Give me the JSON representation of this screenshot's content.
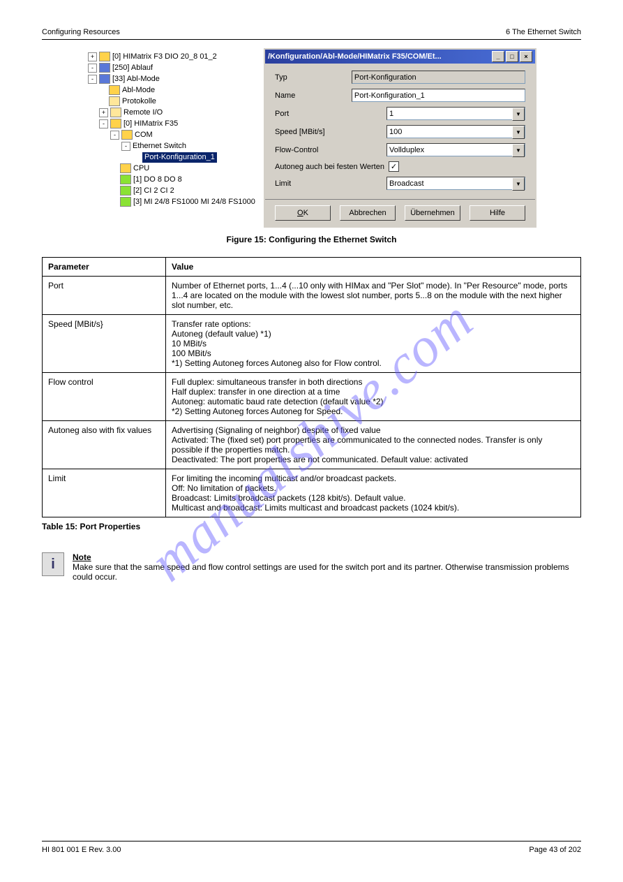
{
  "header": {
    "left": "Configuring Resources",
    "right": "6 The Ethernet Switch"
  },
  "footer": {
    "left": "HI 801 001 E Rev. 3.00",
    "right": "Page 43 of 202"
  },
  "watermark": "manualshive.com",
  "tree": [
    {
      "indent": 0,
      "exp": "+",
      "icon": "ico",
      "label": "[0] HIMatrix F3 DIO 20_8 01_2"
    },
    {
      "indent": 0,
      "exp": "-",
      "icon": "ico-blue",
      "label": "[250] Ablauf"
    },
    {
      "indent": 0,
      "exp": "-",
      "icon": "ico-blue",
      "label": "[33] Abl-Mode"
    },
    {
      "indent": 1,
      "exp": "",
      "icon": "ico",
      "label": "Abl-Mode"
    },
    {
      "indent": 1,
      "exp": "",
      "icon": "ico-folder",
      "label": "Protokolle"
    },
    {
      "indent": 1,
      "exp": "+",
      "icon": "ico-folder",
      "label": "Remote I/O"
    },
    {
      "indent": 1,
      "exp": "-",
      "icon": "ico",
      "label": "[0] HIMatrix F35"
    },
    {
      "indent": 2,
      "exp": "-",
      "icon": "ico",
      "label": "COM"
    },
    {
      "indent": 3,
      "exp": "-",
      "icon": "",
      "label": "Ethernet Switch"
    },
    {
      "indent": 4,
      "exp": "",
      "icon": "",
      "label": "Port-Konfiguration_1",
      "selected": true
    },
    {
      "indent": 2,
      "exp": "",
      "icon": "ico",
      "label": "CPU"
    },
    {
      "indent": 2,
      "exp": "",
      "icon": "ico-green",
      "label": "[1] DO 8 DO 8"
    },
    {
      "indent": 2,
      "exp": "",
      "icon": "ico-green",
      "label": "[2] CI 2 CI 2"
    },
    {
      "indent": 2,
      "exp": "",
      "icon": "ico-green",
      "label": "[3] MI 24/8 FS1000 MI 24/8 FS1000"
    }
  ],
  "dialog": {
    "title": "/Konfiguration/Abl-Mode/HIMatrix F35/COM/Et...",
    "fields": {
      "typ": {
        "label": "Typ",
        "value": "Port-Konfiguration"
      },
      "name": {
        "label": "Name",
        "value": "Port-Konfiguration_1"
      },
      "port": {
        "label": "Port",
        "value": "1"
      },
      "speed": {
        "label": "Speed [MBit/s]",
        "value": "100"
      },
      "flow": {
        "label": "Flow-Control",
        "value": "Vollduplex"
      },
      "autoneg": {
        "label": "Autoneg auch bei festen Werten",
        "checked": true
      },
      "limit": {
        "label": "Limit",
        "value": "Broadcast"
      }
    },
    "buttons": {
      "ok": "OK",
      "cancel": "Abbrechen",
      "apply": "Übernehmen",
      "help": "Hilfe"
    }
  },
  "figure": {
    "num": "Figure 15: ",
    "text": "Configuring the Ethernet Switch"
  },
  "table": {
    "head": {
      "c1": "Parameter",
      "c2": "Value"
    },
    "rows": [
      {
        "c1": "Port",
        "c2": "Number of Ethernet ports, 1...4 (...10 only with HIMax and \"Per Slot\" mode). In \"Per Resource\" mode, ports 1...4 are located on the module with the lowest slot number, ports 5...8 on the module with the next higher slot number, etc."
      },
      {
        "c1": "Speed [MBit/s}",
        "c2": "Transfer rate options:\nAutoneg (default value) *1)\n10 MBit/s\n100 MBit/s\n*1) Setting Autoneg forces Autoneg also for Flow control."
      },
      {
        "c1": "Flow control",
        "c2": "Full duplex: simultaneous transfer in both directions\nHalf duplex: transfer in one direction at a time\nAutoneg: automatic baud rate detection (default value *2)\n*2) Setting Autoneg forces Autoneg for Speed."
      },
      {
        "c1": "Autoneg also with fix values",
        "c2": "Advertising (Signaling of neighbor) despite of fixed value\nActivated: The (fixed set) port properties are communicated to the connected nodes. Transfer is only possible if the properties match.\nDeactivated: The port properties are not communicated. Default value: activated"
      },
      {
        "c1": "Limit",
        "c2": "For limiting the incoming multicast and/or broadcast packets.\nOff: No limitation of packets.\nBroadcast: Limits broadcast packets (128 kbit/s). Default value.\nMulticast and broadcast: Limits multicast and broadcast packets (1024 kbit/s)."
      }
    ],
    "caption_num": "Table 15: ",
    "caption_text": "Port Properties"
  },
  "note": {
    "head": "Note",
    "body": "Make sure that the same speed and flow control settings are used for the switch port and its partner. Otherwise transmission problems could occur."
  }
}
